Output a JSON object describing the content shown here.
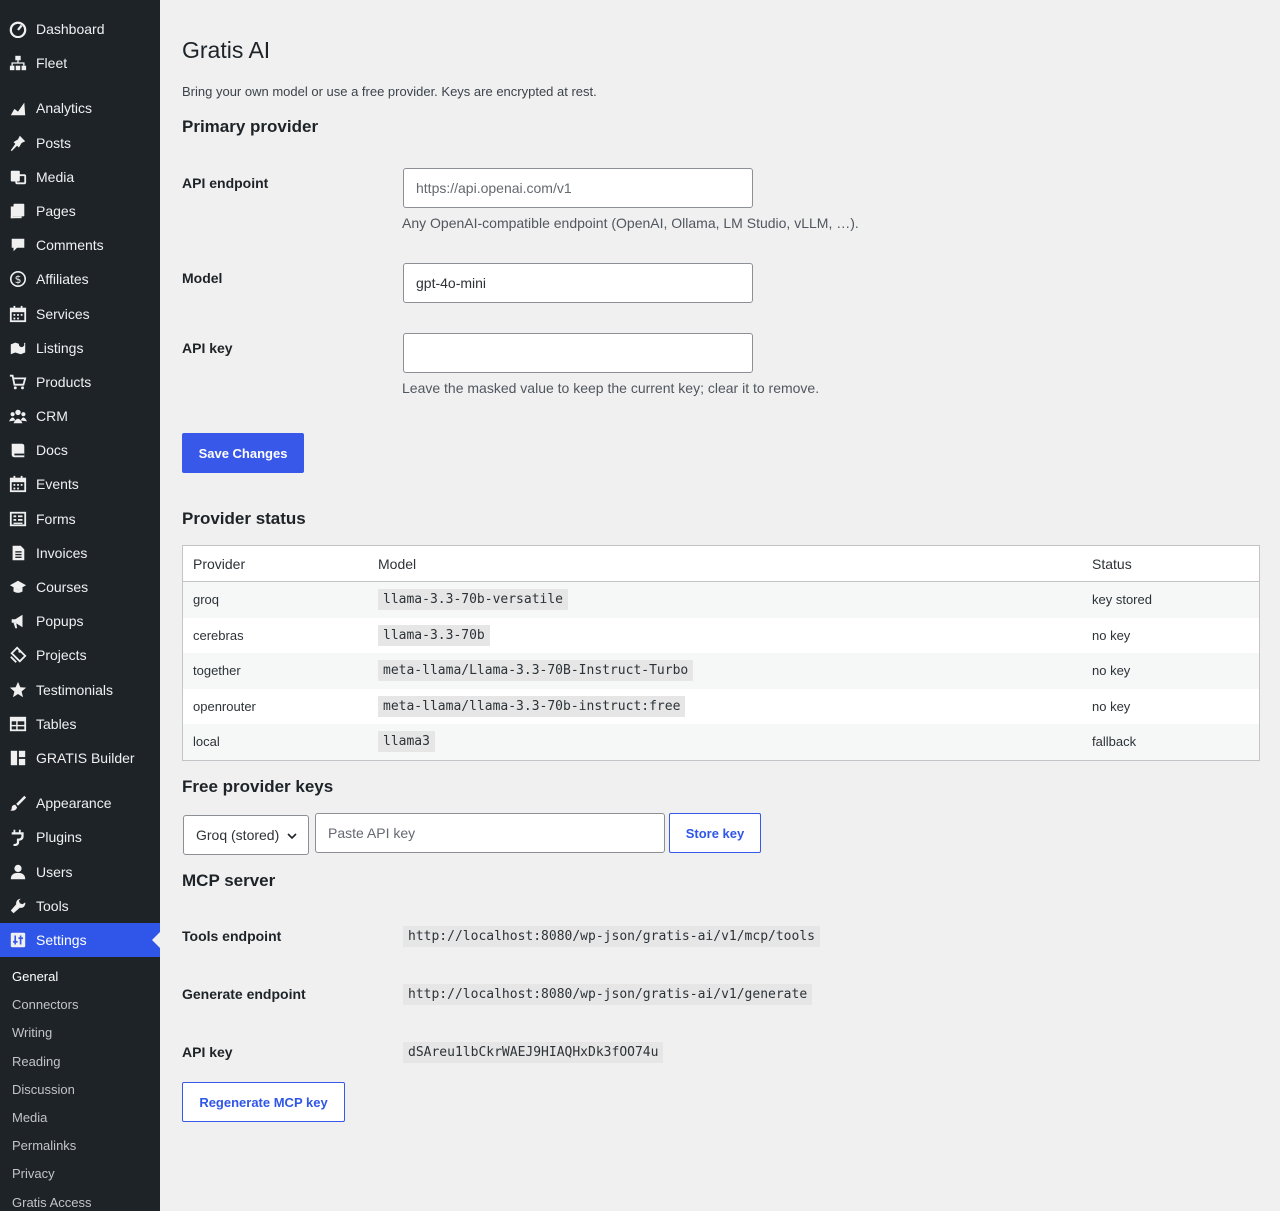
{
  "sidebar": {
    "items": [
      {
        "label": "Dashboard",
        "icon": "dashboard-icon"
      },
      {
        "label": "Fleet",
        "icon": "network-icon"
      },
      {
        "label": "Analytics",
        "icon": "chart-icon"
      },
      {
        "label": "Posts",
        "icon": "pin-icon"
      },
      {
        "label": "Media",
        "icon": "media-icon"
      },
      {
        "label": "Pages",
        "icon": "pages-icon"
      },
      {
        "label": "Comments",
        "icon": "comment-icon"
      },
      {
        "label": "Affiliates",
        "icon": "dollar-icon"
      },
      {
        "label": "Services",
        "icon": "calendar-icon"
      },
      {
        "label": "Listings",
        "icon": "map-icon"
      },
      {
        "label": "Products",
        "icon": "cart-icon"
      },
      {
        "label": "CRM",
        "icon": "groups-icon"
      },
      {
        "label": "Docs",
        "icon": "book-icon"
      },
      {
        "label": "Events",
        "icon": "calendar-icon"
      },
      {
        "label": "Forms",
        "icon": "forms-icon"
      },
      {
        "label": "Invoices",
        "icon": "document-icon"
      },
      {
        "label": "Courses",
        "icon": "education-icon"
      },
      {
        "label": "Popups",
        "icon": "megaphone-icon"
      },
      {
        "label": "Projects",
        "icon": "portfolio-icon"
      },
      {
        "label": "Testimonials",
        "icon": "star-icon"
      },
      {
        "label": "Tables",
        "icon": "table-icon"
      },
      {
        "label": "GRATIS Builder",
        "icon": "layout-icon"
      },
      {
        "label": "Appearance",
        "icon": "brush-icon"
      },
      {
        "label": "Plugins",
        "icon": "plugin-icon"
      },
      {
        "label": "Users",
        "icon": "user-icon"
      },
      {
        "label": "Tools",
        "icon": "wrench-icon"
      },
      {
        "label": "Settings",
        "icon": "settings-icon"
      }
    ],
    "submenu": [
      "General",
      "Connectors",
      "Writing",
      "Reading",
      "Discussion",
      "Media",
      "Permalinks",
      "Privacy",
      "Gratis Access"
    ]
  },
  "page": {
    "title": "Gratis AI",
    "description": "Bring your own model or use a free provider. Keys are encrypted at rest."
  },
  "primary": {
    "heading": "Primary provider",
    "endpoint_label": "API endpoint",
    "endpoint_value": "",
    "endpoint_placeholder": "https://api.openai.com/v1",
    "endpoint_help": "Any OpenAI-compatible endpoint (OpenAI, Ollama, LM Studio, vLLM, …).",
    "model_label": "Model",
    "model_value": "gpt-4o-mini",
    "key_label": "API key",
    "key_value": "",
    "key_help": "Leave the masked value to keep the current key; clear it to remove.",
    "save_label": "Save Changes"
  },
  "status": {
    "heading": "Provider status",
    "columns": [
      "Provider",
      "Model",
      "Status"
    ],
    "rows": [
      {
        "provider": "groq",
        "model": "llama-3.3-70b-versatile",
        "status": "key stored"
      },
      {
        "provider": "cerebras",
        "model": "llama-3.3-70b",
        "status": "no key"
      },
      {
        "provider": "together",
        "model": "meta-llama/Llama-3.3-70B-Instruct-Turbo",
        "status": "no key"
      },
      {
        "provider": "openrouter",
        "model": "meta-llama/llama-3.3-70b-instruct:free",
        "status": "no key"
      },
      {
        "provider": "local",
        "model": "llama3",
        "status": "fallback"
      }
    ]
  },
  "free_keys": {
    "heading": "Free provider keys",
    "selected_provider": "Groq (stored)",
    "key_placeholder": "Paste API key",
    "key_value": "",
    "store_label": "Store key"
  },
  "mcp": {
    "heading": "MCP server",
    "tools_label": "Tools endpoint",
    "tools_value": "http://localhost:8080/wp-json/gratis-ai/v1/mcp/tools",
    "generate_label": "Generate endpoint",
    "generate_value": "http://localhost:8080/wp-json/gratis-ai/v1/generate",
    "key_label": "API key",
    "key_value": "dSAreu1lbCkrWAEJ9HIAQHxDk3fOO74u",
    "regenerate_label": "Regenerate MCP key"
  },
  "colors": {
    "sidebar_bg": "#1d2327",
    "accent": "#3858e9",
    "page_bg": "#f0f0f1"
  }
}
